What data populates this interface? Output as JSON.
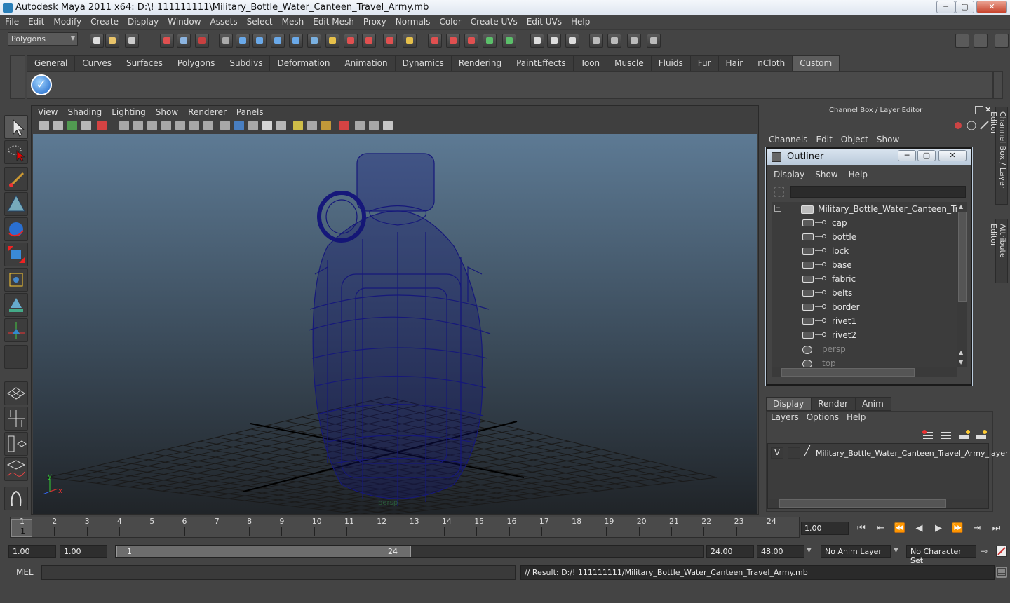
{
  "window": {
    "title": "Autodesk Maya 2011 x64: D:\\! 111111111\\Military_Bottle_Water_Canteen_Travel_Army.mb",
    "minimize": "─",
    "maximize": "▢",
    "close": "✕"
  },
  "menubar": [
    "File",
    "Edit",
    "Modify",
    "Create",
    "Display",
    "Window",
    "Assets",
    "Select",
    "Mesh",
    "Edit Mesh",
    "Proxy",
    "Normals",
    "Color",
    "Create UVs",
    "Edit UVs",
    "Help"
  ],
  "status_line": {
    "menu_set": "Polygons"
  },
  "shelf": {
    "tabs": [
      "General",
      "Curves",
      "Surfaces",
      "Polygons",
      "Subdivs",
      "Deformation",
      "Animation",
      "Dynamics",
      "Rendering",
      "PaintEffects",
      "Toon",
      "Muscle",
      "Fluids",
      "Fur",
      "Hair",
      "nCloth",
      "Custom"
    ],
    "active_tab": "Custom",
    "button_icon": "checkmark-icon",
    "button_glyph": "✓"
  },
  "viewport": {
    "menu": [
      "View",
      "Shading",
      "Lighting",
      "Show",
      "Renderer",
      "Panels"
    ],
    "camera_label": "persp"
  },
  "channel_box": {
    "title": "Channel Box / Layer Editor",
    "menu": [
      "Channels",
      "Edit",
      "Object",
      "Show"
    ],
    "side_tabs": [
      "Channel Box / Layer Editor",
      "Attribute Editor"
    ]
  },
  "outliner": {
    "title": "Outliner",
    "menu": [
      "Display",
      "Show",
      "Help"
    ],
    "root": "Military_Bottle_Water_Canteen_Travel",
    "children": [
      "cap",
      "bottle",
      "lock",
      "base",
      "fabric",
      "belts",
      "border",
      "rivet1",
      "rivet2"
    ],
    "cameras": [
      "persp",
      "top"
    ]
  },
  "layer_editor": {
    "tabs": [
      "Display",
      "Render",
      "Anim"
    ],
    "active_tab": "Display",
    "menu": [
      "Layers",
      "Options",
      "Help"
    ],
    "layer": {
      "visible": "V",
      "name": "Military_Bottle_Water_Canteen_Travel_Army_layer"
    }
  },
  "timeline": {
    "ticks": [
      "1",
      "2",
      "3",
      "4",
      "5",
      "6",
      "7",
      "8",
      "9",
      "10",
      "11",
      "12",
      "13",
      "14",
      "15",
      "16",
      "17",
      "18",
      "19",
      "20",
      "21",
      "22",
      "23",
      "24"
    ],
    "current_frame": "1",
    "current_time": "1.00"
  },
  "range": {
    "start": "1.00",
    "playback_start": "1.00",
    "slider_start": "1",
    "slider_end": "24",
    "playback_end": "24.00",
    "end": "48.00",
    "anim_layer": "No Anim Layer",
    "character_set": "No Character Set"
  },
  "command_line": {
    "label": "MEL",
    "result": "// Result: D:/! 111111111/Military_Bottle_Water_Canteen_Travel_Army.mb"
  },
  "colors": {
    "wireframe": "#16187a",
    "grid": "#1a1a1a",
    "accent": "#5d5d5d"
  }
}
